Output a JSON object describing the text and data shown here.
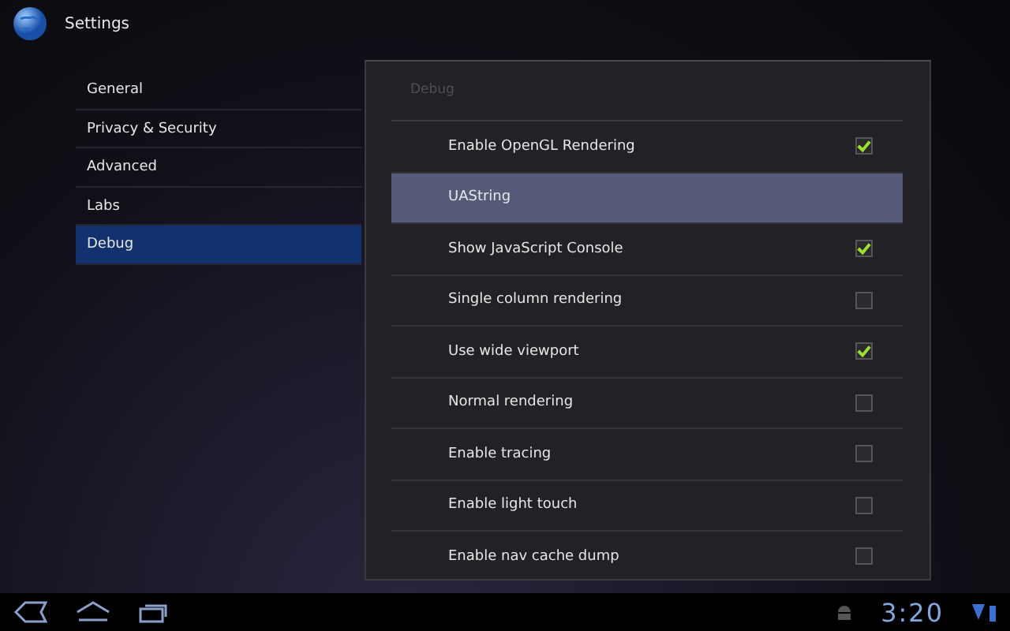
{
  "app_bar": {
    "title": "Settings"
  },
  "sidebar": {
    "items": [
      {
        "label": "General",
        "selected": false
      },
      {
        "label": "Privacy & Security",
        "selected": false
      },
      {
        "label": "Advanced",
        "selected": false
      },
      {
        "label": "Labs",
        "selected": false
      },
      {
        "label": "Debug",
        "selected": true
      }
    ]
  },
  "panel": {
    "header": "Debug",
    "rows": [
      {
        "label": "Enable OpenGL Rendering",
        "kind": "checkbox",
        "checked": true,
        "selected": false
      },
      {
        "label": "UAString",
        "kind": "plain",
        "selected": true
      },
      {
        "label": "Show JavaScript Console",
        "kind": "checkbox",
        "checked": true,
        "selected": false
      },
      {
        "label": "Single column rendering",
        "kind": "checkbox",
        "checked": false,
        "selected": false
      },
      {
        "label": "Use wide viewport",
        "kind": "checkbox",
        "checked": true,
        "selected": false
      },
      {
        "label": "Normal rendering",
        "kind": "checkbox",
        "checked": false,
        "selected": false
      },
      {
        "label": "Enable tracing",
        "kind": "checkbox",
        "checked": false,
        "selected": false
      },
      {
        "label": "Enable light touch",
        "kind": "checkbox",
        "checked": false,
        "selected": false
      },
      {
        "label": "Enable nav cache dump",
        "kind": "checkbox",
        "checked": false,
        "selected": false
      }
    ]
  },
  "system_bar": {
    "clock": "3:20"
  }
}
